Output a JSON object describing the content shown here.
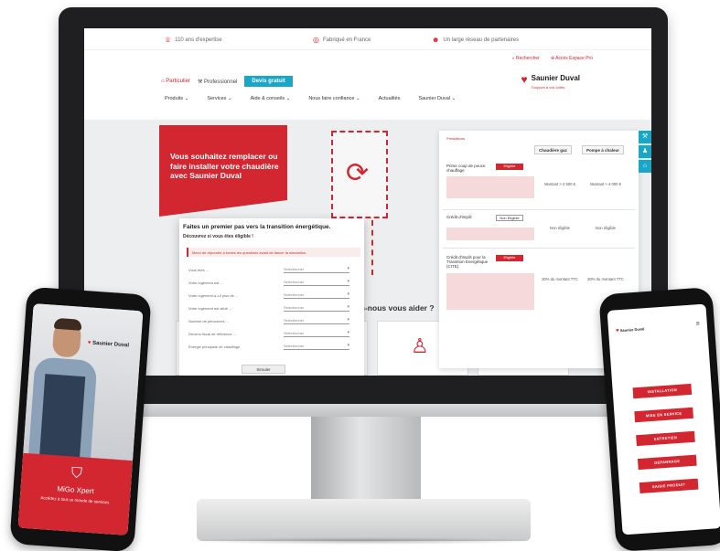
{
  "infobar": {
    "item1": "110 ans d'expertise",
    "item2": "Fabriqué en France",
    "item3": "Un large réseau de partenaires"
  },
  "toplinks": {
    "search": "Rechercher",
    "pro_space": "Accès Espace Pro"
  },
  "brand": {
    "name": "Saunier Duval",
    "tagline": "Toujours à vos côtés",
    "accent": "#d22630",
    "secondary": "#18a6c9"
  },
  "tabs": {
    "particulier": "Particulier",
    "professionnel": "Professionnel",
    "devis": "Devis gratuit"
  },
  "nav": [
    "Produits",
    "Services",
    "Aide & conseils",
    "Nous faire confiance",
    "Actualités",
    "Saunier Duval"
  ],
  "hero": {
    "title": "Vous souhaitez remplacer ou faire installer votre chaudière avec Saunier Duval"
  },
  "how": {
    "title": "Comment pouvons-nous vous aider ?"
  },
  "comparison": {
    "heading": "Prestations",
    "col1": "Chaudière gaz",
    "col2": "Pompe à chaleur",
    "rows": [
      {
        "label": "Prime coup de pouce chauffage",
        "tag": "Eligible",
        "c1": "Montant > 2 500 €",
        "c2": "Montant > 4 000 €"
      },
      {
        "label": "Crédit d'impôt",
        "tag": "Non Eligible",
        "c1": "Non éligible",
        "c2": "Non éligible"
      },
      {
        "label": "Crédit d'impôt pour la Transition Energétique (CITE)",
        "tag": "Eligible",
        "c1": "30% du montant TTC",
        "c2": "30% du montant TTC"
      }
    ]
  },
  "form": {
    "title": "Faites un premier pas vers la transition énergétique.",
    "subtitle": "Découvrez si vous êtes éligible !",
    "note": "Merci de répondre à toutes les questions avant de lancer la simulation.",
    "fields": [
      {
        "label": "Vous êtes ...",
        "value": "Sélectionner"
      },
      {
        "label": "Votre logement est ...",
        "value": "Sélectionner"
      },
      {
        "label": "Votre logement a-t-il plus de ...",
        "value": "Sélectionner"
      },
      {
        "label": "Votre logement est situé ...",
        "value": "Sélectionner"
      },
      {
        "label": "Nombre de personnes ...",
        "value": "Sélectionner"
      },
      {
        "label": "Revenu fiscal de référence ...",
        "value": "Sélectionner"
      },
      {
        "label": "Énergie principale de chauffage",
        "value": "Sélectionner"
      }
    ],
    "submit": "Simuler"
  },
  "phone_left": {
    "brand": "Saunier Duval",
    "title": "MiGo Xpert",
    "subtitle": "Accédez à tout un monde de services"
  },
  "phone_right": {
    "brand": "Saunier Duval",
    "buttons": [
      "INSTALLATION",
      "MISE EN SERVICE",
      "ENTRETIEN",
      "DEPANNAGE",
      "SAISIE PRODUIT"
    ]
  }
}
